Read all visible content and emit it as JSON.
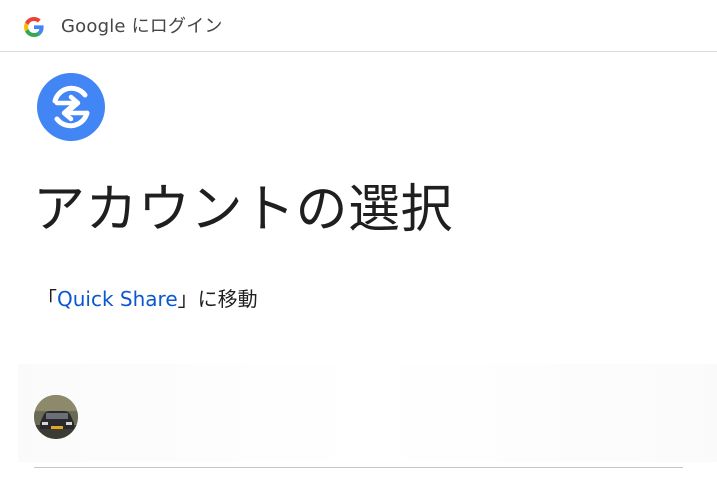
{
  "header": {
    "logo_icon": "google-g-icon",
    "title": "Google にログイン"
  },
  "app": {
    "icon": "quick-share-icon",
    "icon_color": "#4285f4"
  },
  "main": {
    "heading": "アカウントの選択",
    "subtitle_open_bracket": "「",
    "subtitle_app_name": "Quick Share",
    "subtitle_close": "」に移動"
  },
  "account": {
    "avatar_icon": "avatar-photo-car"
  },
  "colors": {
    "link": "#0b57d0",
    "text": "#1f1f1f",
    "divider": "#c4c7c5"
  }
}
